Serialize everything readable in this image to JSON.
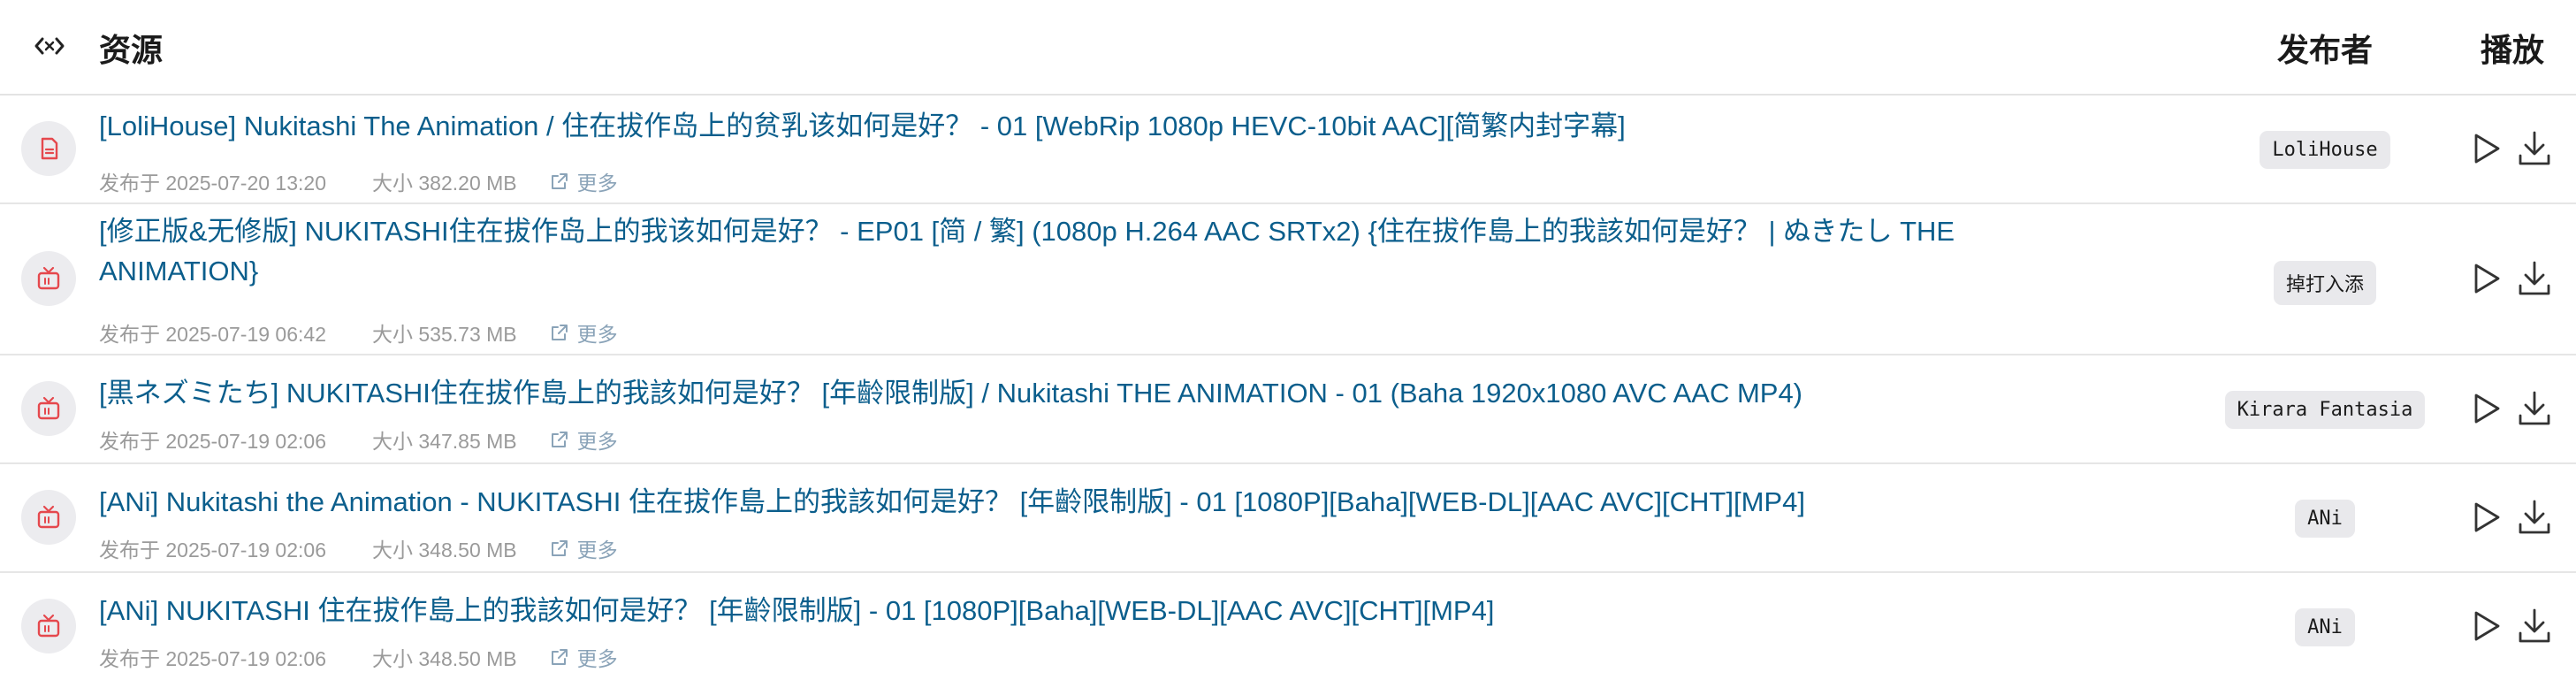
{
  "header": {
    "title": "资源",
    "publisher": "发布者",
    "play": "播放",
    "toggle_icon": "code-toggle-icon"
  },
  "rows": [
    {
      "icon": "document-icon",
      "title": "[LoliHouse] Nukitashi The Animation / 住在拔作岛上的贫乳该如何是好？ - 01 [WebRip 1080p HEVC-10bit AAC][简繁内封字幕]",
      "date": "发布于 2025-07-20 13:20",
      "size": "大小 382.20 MB",
      "more": "更多",
      "publisher": "LoliHouse"
    },
    {
      "icon": "tv-icon",
      "title": "[修正版&无修版] NUKITASHI住在拔作岛上的我该如何是好？ - EP01 [简 / 繁] (1080p H.264 AAC SRTx2) {住在拔作島上的我該如何是好？ | ぬきたし THE ANIMATION}",
      "date": "发布于 2025-07-19 06:42",
      "size": "大小 535.73 MB",
      "more": "更多",
      "publisher": "掉打入添"
    },
    {
      "icon": "tv-icon",
      "title": "[黒ネズミたち] NUKITASHI住在拔作島上的我該如何是好？ [年齡限制版] / Nukitashi THE ANIMATION - 01 (Baha 1920x1080 AVC AAC MP4)",
      "date": "发布于 2025-07-19 02:06",
      "size": "大小 347.85 MB",
      "more": "更多",
      "publisher": "Kirara Fantasia"
    },
    {
      "icon": "tv-icon",
      "title": "[ANi] Nukitashi the Animation - NUKITASHI 住在拔作島上的我該如何是好？ [年齡限制版] - 01 [1080P][Baha][WEB-DL][AAC AVC][CHT][MP4]",
      "date": "发布于 2025-07-19 02:06",
      "size": "大小 348.50 MB",
      "more": "更多",
      "publisher": "ANi"
    },
    {
      "icon": "tv-icon",
      "title": "[ANi] NUKITASHI 住在拔作島上的我該如何是好？ [年齡限制版] - 01 [1080P][Baha][WEB-DL][AAC AVC][CHT][MP4]",
      "date": "发布于 2025-07-19 02:06",
      "size": "大小 348.50 MB",
      "more": "更多",
      "publisher": "ANi"
    }
  ],
  "colors": {
    "link": "#0b5e8c",
    "icon_red": "#e5484d",
    "meta_gray": "#9a9a9a"
  }
}
